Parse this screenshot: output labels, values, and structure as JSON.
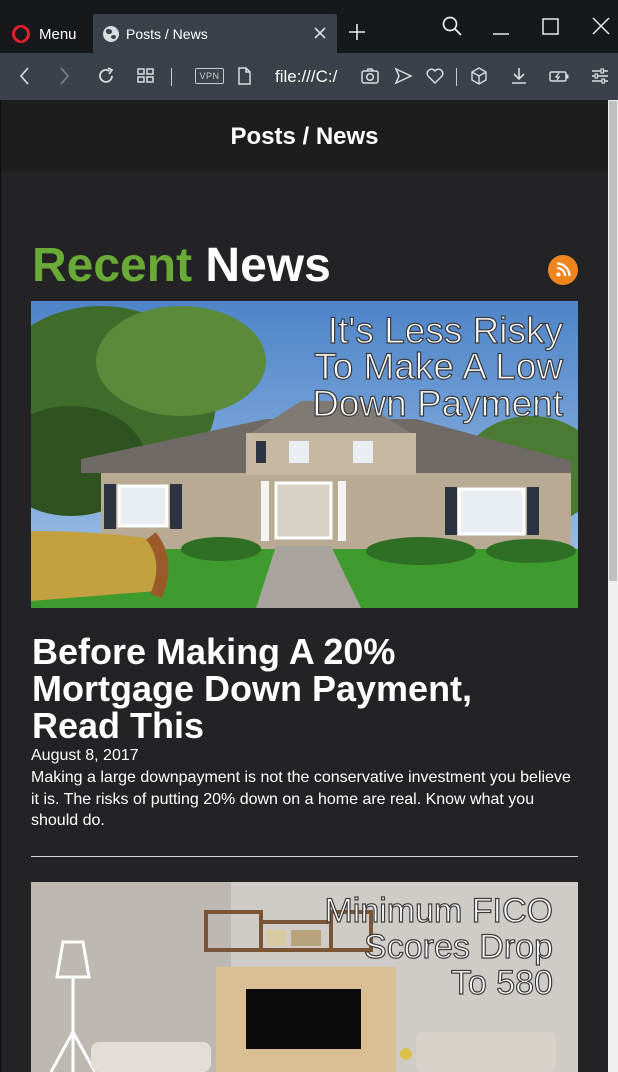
{
  "browser": {
    "menu_label": "Menu",
    "tab_title": "Posts / News",
    "address": "file:///C:/",
    "vpn_label": "VPN"
  },
  "page": {
    "header_title": "Posts / News",
    "section_title_part1": "Recent",
    "section_title_part2": "News"
  },
  "posts": [
    {
      "image_caption_lines": [
        "It's Less Risky",
        "To Make A Low",
        "Down Payment"
      ],
      "title": "Before Making A 20% Mortgage Down Payment, Read This",
      "date": "August 8, 2017",
      "excerpt": "Making a large downpayment is not the conservative investment you believe it is. The risks of putting 20% down on a home are real. Know what you should do."
    },
    {
      "image_caption_lines": [
        "Minimum FICO",
        "Scores Drop",
        "To 580"
      ]
    }
  ],
  "colors": {
    "accent_green": "#6aaa37",
    "rss_orange": "#f0851f",
    "page_bg": "#232325",
    "header_bg": "#1d1d1e",
    "chrome_bg": "#3b4148"
  },
  "icons": [
    "opera-logo-icon",
    "globe-icon",
    "close-icon",
    "plus-icon",
    "search-icon",
    "minimize-icon",
    "maximize-icon",
    "back-icon",
    "forward-icon",
    "reload-icon",
    "tabs-grid-icon",
    "file-icon",
    "camera-icon",
    "send-icon",
    "heart-icon",
    "cube-icon",
    "download-icon",
    "battery-icon",
    "settings-sliders-icon",
    "rss-icon"
  ]
}
